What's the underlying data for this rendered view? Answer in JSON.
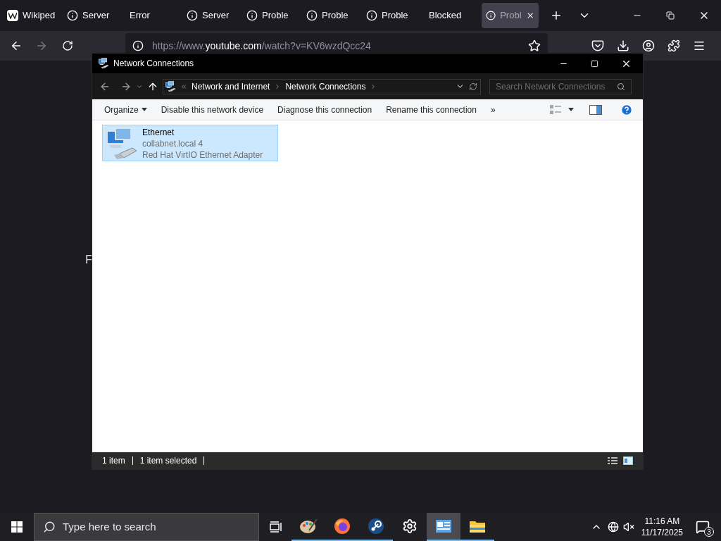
{
  "browser": {
    "tabs": [
      {
        "label": "Wikiped",
        "kind": "wikipedia",
        "selected": false
      },
      {
        "label": "Server",
        "kind": "info",
        "selected": false
      },
      {
        "label": "Error",
        "kind": "plain",
        "selected": false
      },
      {
        "label": "Server",
        "kind": "info",
        "selected": false
      },
      {
        "label": "Proble",
        "kind": "info",
        "selected": false
      },
      {
        "label": "Proble",
        "kind": "info",
        "selected": false
      },
      {
        "label": "Proble",
        "kind": "info",
        "selected": false
      },
      {
        "label": "Blocked",
        "kind": "plain",
        "selected": false
      },
      {
        "label": "Probl",
        "kind": "info",
        "selected": true
      }
    ],
    "url": {
      "scheme": "https://www.",
      "domain": "youtube.com",
      "path": "/watch?v=KV6wzdQcc24"
    },
    "page_text": "F"
  },
  "explorer": {
    "title": "Network Connections",
    "breadcrumb": [
      "Network and Internet",
      "Network Connections"
    ],
    "search": {
      "placeholder": "Search Network Connections"
    },
    "commands": [
      {
        "label": "Organize",
        "kind": "menu"
      },
      {
        "label": "Disable this network device",
        "kind": "plain"
      },
      {
        "label": "Diagnose this connection",
        "kind": "plain"
      },
      {
        "label": "Rename this connection",
        "kind": "plain"
      },
      {
        "label": "»",
        "kind": "plain"
      }
    ],
    "items": [
      {
        "name": "Ethernet",
        "network": "collabnet.local 4",
        "adapter": "Red Hat VirtIO Ethernet Adapter",
        "selected": true
      }
    ],
    "status": [
      "1 item",
      "1 item selected"
    ]
  },
  "taskbar": {
    "search": {
      "placeholder": "Type here to search"
    },
    "apps": [
      {
        "kind": "paint",
        "running": true,
        "active": false
      },
      {
        "kind": "firefox",
        "running": true,
        "active": false
      },
      {
        "kind": "steam",
        "running": true,
        "active": false
      },
      {
        "kind": "settings",
        "running": false,
        "active": false
      },
      {
        "kind": "network",
        "running": true,
        "active": true
      },
      {
        "kind": "folder",
        "running": true,
        "active": false
      }
    ],
    "time": "11:16 AM",
    "date": "11/17/2025",
    "notifications": "3"
  }
}
